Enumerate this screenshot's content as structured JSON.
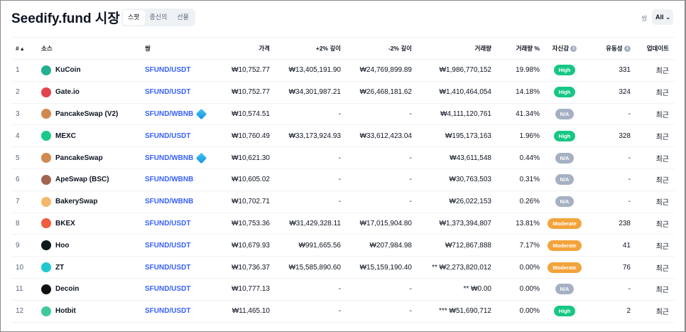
{
  "header": {
    "title": "Seedify.fund 시장",
    "tabs": [
      "스팟",
      "종신의",
      "선물"
    ],
    "pair_label": "쌍",
    "pair_filter": "All"
  },
  "columns": [
    "#",
    "소스",
    "쌍",
    "가격",
    "+2% 깊이",
    "-2% 깊이",
    "거래량",
    "거래량 %",
    "자신감",
    "유동성",
    "업데이트"
  ],
  "colors": {
    "high": "#16c784",
    "na": "#a6b0c3",
    "moderate": "#f3a33b",
    "link": "#3861fb"
  },
  "rows": [
    {
      "n": "1",
      "src": "KuCoin",
      "logo": "#23af91",
      "pair": "SFUND/USDT",
      "price": "₩10,752.77",
      "p2": "₩13,405,191.90",
      "m2": "₩24,769,899.89",
      "vol": "₩1,986,770,152",
      "volp": "19.98%",
      "conf": "High",
      "liq": "331",
      "upd": "최근"
    },
    {
      "n": "2",
      "src": "Gate.io",
      "logo": "#e2434d",
      "pair": "SFUND/USDT",
      "price": "₩10,752.77",
      "p2": "₩34,301,987.21",
      "m2": "₩26,468,181.62",
      "vol": "₩1,410,464,054",
      "volp": "14.18%",
      "conf": "High",
      "liq": "324",
      "upd": "최근"
    },
    {
      "n": "3",
      "src": "PancakeSwap (V2)",
      "logo": "#d1884f",
      "pair": "SFUND/WBNB",
      "wbnb": true,
      "price": "₩10,574.51",
      "p2": "-",
      "m2": "-",
      "vol": "₩4,111,120,761",
      "volp": "41.34%",
      "conf": "N/A",
      "liq": "-",
      "upd": "최근"
    },
    {
      "n": "4",
      "src": "MEXC",
      "logo": "#1ac98b",
      "pair": "SFUND/USDT",
      "price": "₩10,760.49",
      "p2": "₩33,173,924.93",
      "m2": "₩33,612,423.04",
      "vol": "₩195,173,163",
      "volp": "1.96%",
      "conf": "High",
      "liq": "328",
      "upd": "최근"
    },
    {
      "n": "5",
      "src": "PancakeSwap",
      "logo": "#d1884f",
      "pair": "SFUND/WBNB",
      "wbnb": true,
      "price": "₩10,621.30",
      "p2": "-",
      "m2": "-",
      "vol": "₩43,611,548",
      "volp": "0.44%",
      "conf": "N/A",
      "liq": "-",
      "upd": "최근"
    },
    {
      "n": "6",
      "src": "ApeSwap (BSC)",
      "logo": "#a16552",
      "pair": "SFUND/WBNB",
      "price": "₩10,605.02",
      "p2": "-",
      "m2": "-",
      "vol": "₩30,763,503",
      "volp": "0.31%",
      "conf": "N/A",
      "liq": "-",
      "upd": "최근"
    },
    {
      "n": "7",
      "src": "BakerySwap",
      "logo": "#f5b86b",
      "pair": "SFUND/WBNB",
      "price": "₩10,702.71",
      "p2": "-",
      "m2": "-",
      "vol": "₩26,022,153",
      "volp": "0.26%",
      "conf": "N/A",
      "liq": "-",
      "upd": "최근"
    },
    {
      "n": "8",
      "src": "BKEX",
      "logo": "#f05c3e",
      "pair": "SFUND/USDT",
      "price": "₩10,753.36",
      "p2": "₩31,429,328.11",
      "m2": "₩17,015,904.80",
      "vol": "₩1,373,394,807",
      "volp": "13.81%",
      "conf": "Moderate",
      "liq": "238",
      "upd": "최근"
    },
    {
      "n": "9",
      "src": "Hoo",
      "logo": "#0b1a1a",
      "pair": "SFUND/USDT",
      "price": "₩10,679.93",
      "p2": "₩991,665.56",
      "m2": "₩207,984.98",
      "vol": "₩712,867,888",
      "volp": "7.17%",
      "conf": "Moderate",
      "liq": "41",
      "upd": "최근"
    },
    {
      "n": "10",
      "src": "ZT",
      "logo": "#21c6d3",
      "pair": "SFUND/USDT",
      "price": "₩10,736.37",
      "p2": "₩15,585,890.60",
      "m2": "₩15,159,190.40",
      "vol": "** ₩2,273,820,012",
      "volp": "0.00%",
      "conf": "Moderate",
      "liq": "76",
      "upd": "최근"
    },
    {
      "n": "11",
      "src": "Decoin",
      "logo": "#111111",
      "pair": "SFUND/USDT",
      "price": "₩10,777.13",
      "p2": "-",
      "m2": "-",
      "vol": "** ₩0.00",
      "volp": "0.00%",
      "conf": "N/A",
      "liq": "-",
      "upd": "최근"
    },
    {
      "n": "12",
      "src": "Hotbit",
      "logo": "#3fc99a",
      "pair": "SFUND/USDT",
      "price": "₩11,465.10",
      "p2": "-",
      "m2": "-",
      "vol": "*** ₩51,690,712",
      "volp": "0.00%",
      "conf": "High",
      "liq": "2",
      "upd": "최근"
    }
  ]
}
